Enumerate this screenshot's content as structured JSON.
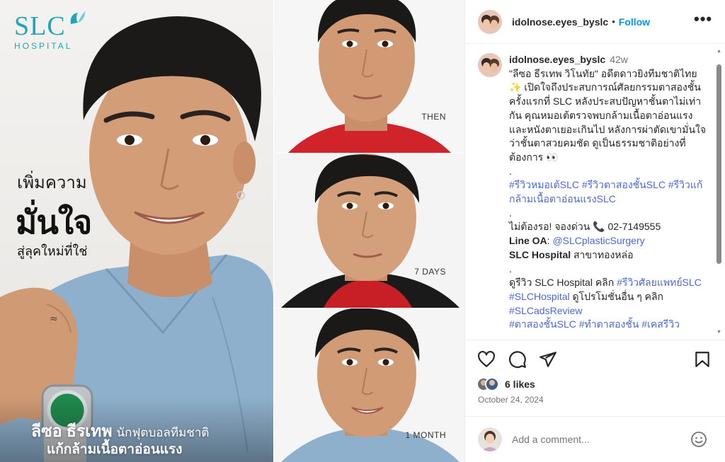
{
  "ad": {
    "logo_main": "SLC",
    "logo_sub": "HOSPITAL",
    "tagline_small": "เพิ่มความ",
    "tagline_big": "มั่นใจ",
    "tagline_sub": "สู่ลุคใหม่ที่ใช่",
    "caption_name": "ลีซอ ธีรเทพ",
    "caption_role": "นักฟุตบอลทีมชาติ",
    "caption_line2": "แก้กล้ามเนื้อตาอ่อนแรง",
    "panels": [
      "THEN",
      "7 DAYS",
      "1 MONTH"
    ]
  },
  "header": {
    "username": "idolnose.eyes_byslc",
    "separator": "•",
    "follow_label": "Follow",
    "more_label": "•••"
  },
  "caption": {
    "username": "idolnose.eyes_byslc",
    "time": "42w",
    "p1": "\"ลีซอ ธีรเทพ วิโนทัย\" อดีตดาวยิงทีมชาติไทย ✨ เปิดใจถึงประสบการณ์ศัลยกรรมตาสองชั้นครั้งแรกที่ SLC หลังประสบปัญหาชั้นตาไม่เท่ากัน คุณหมอเต้ตรวจพบกล้ามเนื้อตาอ่อนแรงและหนังตาเยอะเกินไป หลังการผ่าตัดเขามั่นใจว่าชั้นตาสวยคมชัด ดูเป็นธรรมชาติอย่างที่ต้องการ 👀",
    "dot": ".",
    "hash1": "#รีวิวหมอเต้SLC",
    "hash2": "#รีวิวตาสองชั้นSLC",
    "hash3": "#รีวิวแก้กล้ามเนื้อตาอ่อนแรงSLC",
    "call_text": "ไม่ต้องรอ! จองด่วน 📞 02-7149555",
    "line_label": "Line OA",
    "line_colon": ": ",
    "line_handle": "@SLCplasticSurgery",
    "branch_bold": "SLC Hospital",
    "branch_rest": " สาขาทองหล่อ",
    "review_text": "ดูรีวิว SLC Hospital คลิก ",
    "hash4": "#รีวิวศัลยแพทย์SLC",
    "hash5": "#SLCHospital",
    "promo_text": " ดูโปรโมชั่นอื่น ๆ คลิก",
    "hash6": "#SLCadsReview",
    "hash_cut": "#ตาสองชั้นSLC #ทำตาสองชั้น #เคสรีวิว"
  },
  "scrollbar": {
    "up": "▲",
    "down": "▼"
  },
  "engagement": {
    "likes": "6 likes",
    "date": "October 24, 2024"
  },
  "comment": {
    "placeholder": "Add a comment..."
  },
  "colors": {
    "link": "#4c68d7",
    "follow": "#0095f6",
    "brand_teal": "#1fa7b8"
  }
}
